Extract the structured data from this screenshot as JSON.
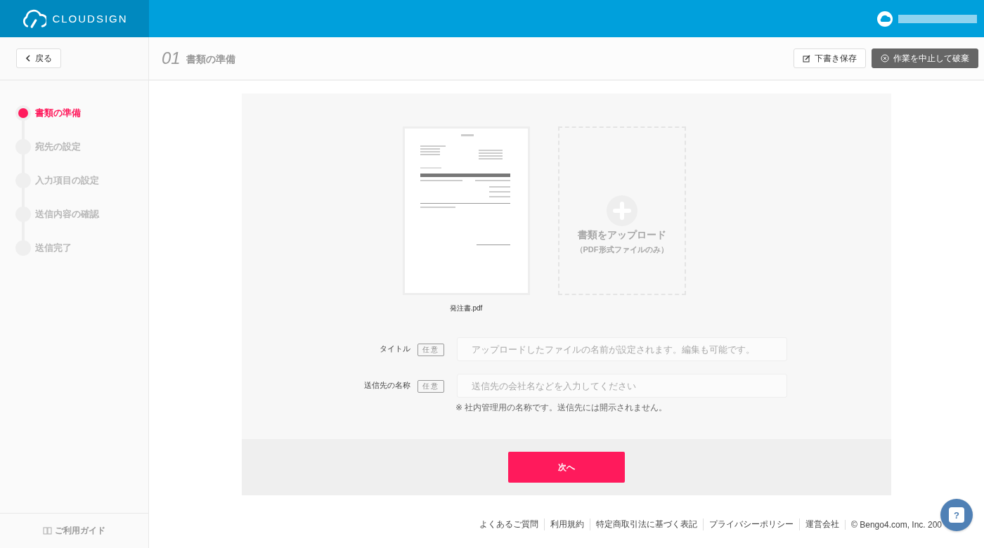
{
  "header": {
    "logo": "CLOUDSIGN"
  },
  "toolbar": {
    "back": "戻る",
    "step_number": "01",
    "step_title": "書類の準備",
    "save_draft": "下書き保存",
    "discard": "作業を中止して破棄"
  },
  "steps": [
    {
      "label": "書類の準備",
      "selected": true
    },
    {
      "label": "宛先の設定",
      "selected": false
    },
    {
      "label": "入力項目の設定",
      "selected": false
    },
    {
      "label": "送信内容の確認",
      "selected": false
    },
    {
      "label": "送信完了",
      "selected": false
    }
  ],
  "sidebar": {
    "guide": "ご利用ガイド"
  },
  "documents": [
    {
      "kind": "file",
      "filename": "発注書.pdf"
    },
    {
      "kind": "upload",
      "title": "書類をアップロード",
      "note": "（PDF形式ファイルのみ）"
    }
  ],
  "fields": [
    {
      "label": "タイトル",
      "badge": "任意",
      "placeholder": "アップロードしたファイルの名前が設定されます。編集も可能です。"
    },
    {
      "label": "送信先の名称",
      "badge": "任意",
      "placeholder": "送信先の会社名などを入力してください",
      "help": "※ 社内管理用の名称です。送信先には開示されません。"
    }
  ],
  "next_button": "次へ",
  "help_button": "?",
  "footer": {
    "links": [
      "よくあるご質問",
      "利用規約",
      "特定商取引法に基づく表記",
      "プライバシーポリシー",
      "運営会社"
    ],
    "copyright": "© Bengo4.com, Inc. 200"
  }
}
